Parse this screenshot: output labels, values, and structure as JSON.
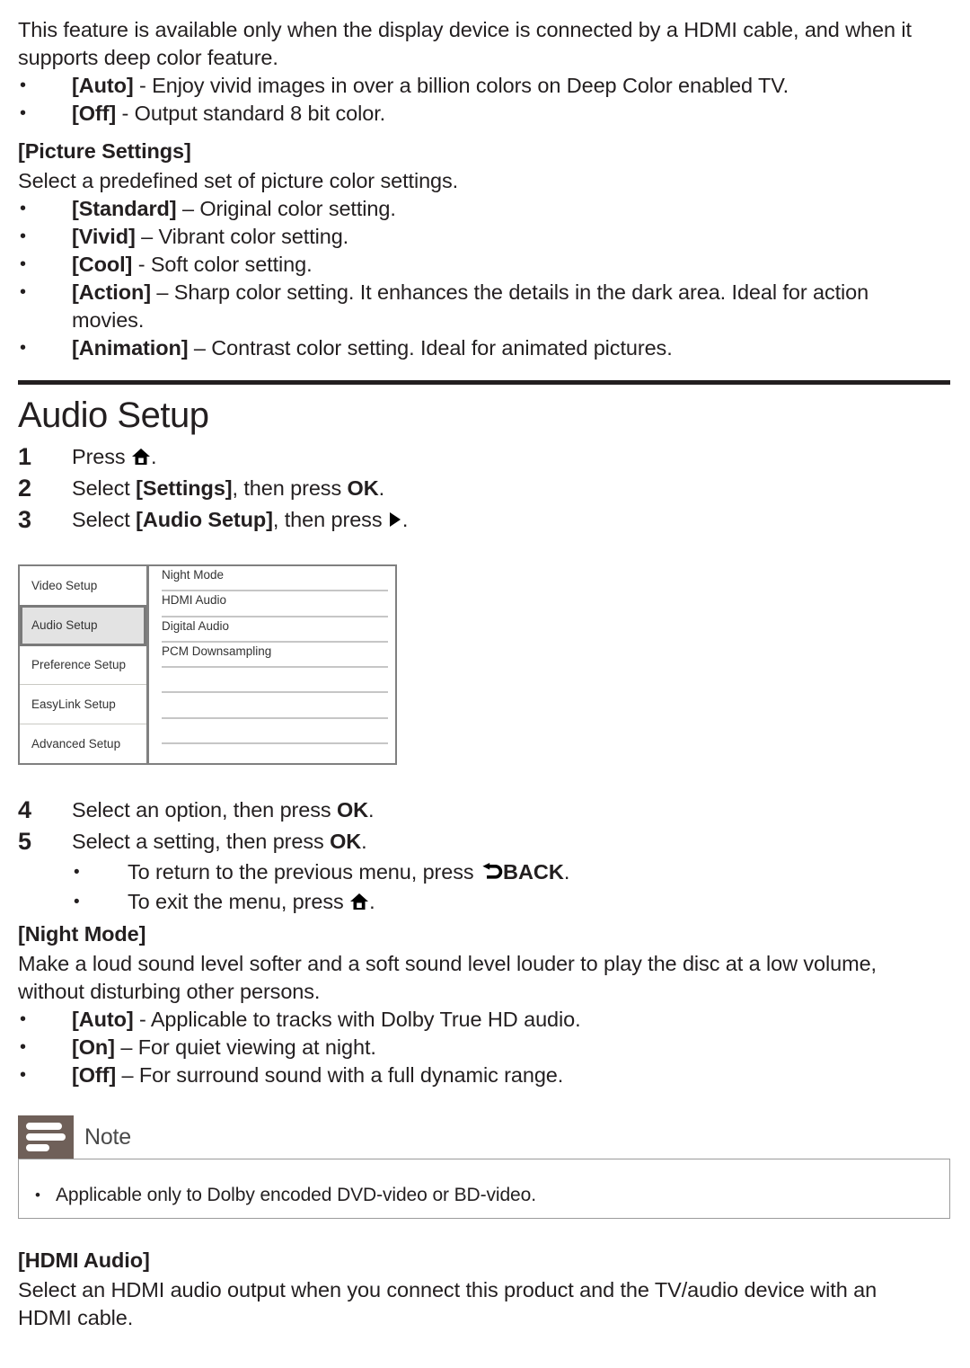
{
  "intro": {
    "paragraph": "This feature is available only when the display device is connected by a HDMI cable, and when it supports deep color feature.",
    "options": [
      {
        "bullet": "•",
        "label": "[Auto]",
        "desc": " - Enjoy vivid images in over a billion colors on Deep Color enabled TV."
      },
      {
        "bullet": "•",
        "label": "[Off]",
        "desc": " - Output standard 8 bit color."
      }
    ]
  },
  "picture_settings": {
    "heading": "[Picture Settings]",
    "paragraph": "Select a predefined set of picture color settings.",
    "options": [
      {
        "bullet": "•",
        "label": "[Standard]",
        "desc": " – Original color setting."
      },
      {
        "bullet": "•",
        "label": "[Vivid]",
        "desc": " – Vibrant color setting."
      },
      {
        "bullet": "•",
        "label": "[Cool]",
        "desc": " - Soft color setting."
      },
      {
        "bullet": "•",
        "label": "[Action]",
        "desc": " – Sharp color setting. It enhances the details in the dark area. Ideal for action movies."
      },
      {
        "bullet": "•",
        "label": "[Animation]",
        "desc": " – Contrast color setting. Ideal for animated pictures."
      }
    ]
  },
  "audio_setup": {
    "title": "Audio Setup",
    "steps": [
      {
        "num": "1",
        "pre": "Press ",
        "icon": "home-icon",
        "post": "."
      },
      {
        "num": "2",
        "pre": "Select ",
        "bold": "[Settings]",
        "mid": ", then press ",
        "bold2": "OK",
        "post": "."
      },
      {
        "num": "3",
        "pre": "Select ",
        "bold": "[Audio Setup]",
        "mid": ", then press ",
        "icon": "play-right-icon",
        "post": "."
      },
      {
        "num": "4",
        "pre": "Select an option, then press ",
        "bold2": "OK",
        "post": "."
      },
      {
        "num": "5",
        "pre": "Select a setting, then press ",
        "bold2": "OK",
        "post": "."
      }
    ],
    "substeps": [
      {
        "bullet": "•",
        "pre": "To return to the previous menu, press ",
        "icon": "back-arrow-icon",
        "bold": "BACK",
        "post": "."
      },
      {
        "bullet": "•",
        "pre": "To exit the menu, press ",
        "icon": "home-icon",
        "post": "."
      }
    ]
  },
  "menu_screenshot": {
    "left_items": [
      {
        "label": "Video Setup",
        "selected": false
      },
      {
        "label": "Audio Setup",
        "selected": true
      },
      {
        "label": "Preference Setup",
        "selected": false
      },
      {
        "label": "EasyLink Setup",
        "selected": false
      },
      {
        "label": "Advanced Setup",
        "selected": false
      }
    ],
    "right_items": [
      {
        "label": "Night Mode"
      },
      {
        "label": "HDMI Audio"
      },
      {
        "label": "Digital Audio"
      },
      {
        "label": "PCM Downsampling"
      },
      {
        "label": ""
      },
      {
        "label": ""
      },
      {
        "label": ""
      },
      {
        "label": ""
      }
    ],
    "selected_fill": "#e3e3e3",
    "border_color": "#808080"
  },
  "night_mode": {
    "heading": "[Night Mode]",
    "paragraph": "Make a loud sound level softer and a soft sound level louder to play the disc at a low volume, without disturbing other persons.",
    "options": [
      {
        "bullet": "•",
        "label": "[Auto]",
        "desc": " - Applicable to tracks with Dolby True HD audio."
      },
      {
        "bullet": "•",
        "label": "[On]",
        "desc": " – For quiet viewing at night."
      },
      {
        "bullet": "•",
        "label": "[Off]",
        "desc": " – For surround sound with a full dynamic range."
      }
    ]
  },
  "note": {
    "label": "Note",
    "bullet": "•",
    "text": "Applicable only to Dolby encoded DVD-video or BD-video.",
    "icon_color": "#6f6059"
  },
  "hdmi_audio": {
    "heading": "[HDMI Audio]",
    "paragraph": "Select an HDMI audio output when you connect this product and the TV/audio device with an HDMI cable."
  }
}
